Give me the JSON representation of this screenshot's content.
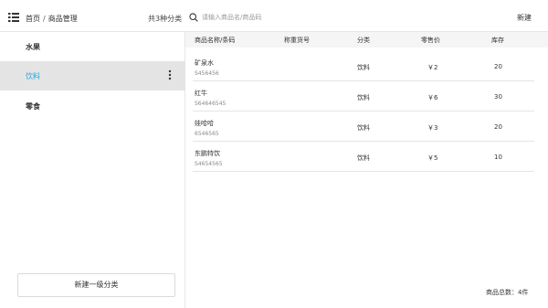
{
  "header": {
    "breadcrumb_home": "首页",
    "breadcrumb_sep": "/",
    "breadcrumb_current": "商品管理",
    "category_count": "共3种分类",
    "search_placeholder": "请输入商品名/商品码",
    "new_label": "新建"
  },
  "sidebar": {
    "categories": [
      {
        "label": "水果",
        "active": false
      },
      {
        "label": "饮料",
        "active": true
      },
      {
        "label": "零食",
        "active": false
      }
    ],
    "add_category_label": "新建一级分类"
  },
  "table": {
    "columns": [
      "商品名称/条码",
      "称重货号",
      "分类",
      "零售价",
      "库存"
    ],
    "rows": [
      {
        "name": "矿泉水",
        "barcode": "S456456",
        "weigh_code": "",
        "category": "饮料",
        "price": "￥2",
        "stock": "20"
      },
      {
        "name": "红牛",
        "barcode": "S64646545",
        "weigh_code": "",
        "category": "饮料",
        "price": "￥6",
        "stock": "30"
      },
      {
        "name": "娃哈哈",
        "barcode": "6546565",
        "weigh_code": "",
        "category": "饮料",
        "price": "￥3",
        "stock": "20"
      },
      {
        "name": "东鹏特饮",
        "barcode": "S4654565",
        "weigh_code": "",
        "category": "饮料",
        "price": "￥5",
        "stock": "10"
      }
    ]
  },
  "footer": {
    "total": "商品总数：4件"
  },
  "colors": {
    "accent": "#1ea9d8",
    "active_bg": "#e4e4e4",
    "page_bg": "#f2f2f2"
  }
}
